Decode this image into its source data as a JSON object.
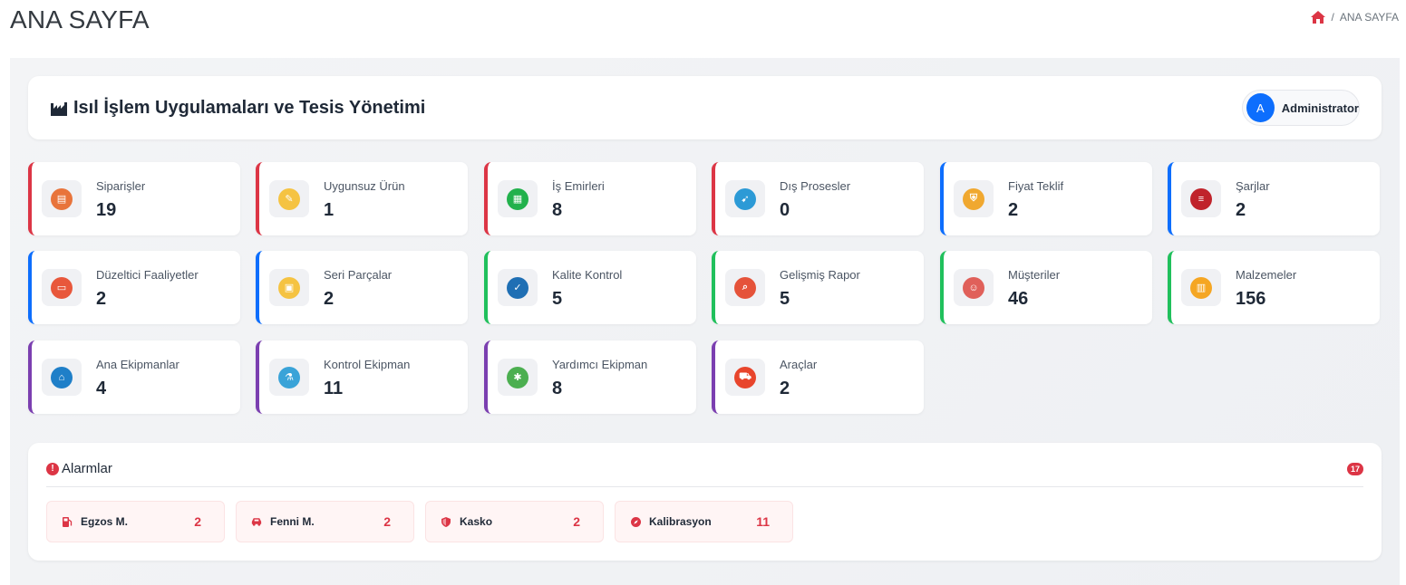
{
  "page": {
    "title": "ANA SAYFA"
  },
  "breadcrumb": {
    "separator": "/",
    "current": "ANA SAYFA"
  },
  "header": {
    "title": "Isıl İşlem Uygulamaları ve Tesis Yönetimi",
    "icon": "factory-icon"
  },
  "user": {
    "initial": "A",
    "name": "Administrator"
  },
  "stats": [
    {
      "label": "Siparişler",
      "value": "19",
      "icon": "orders-icon",
      "accent": "#dc3545",
      "icon_color": "#e8743b"
    },
    {
      "label": "Uygunsuz Ürün",
      "value": "1",
      "icon": "nonconforming-product-icon",
      "accent": "#dc3545",
      "icon_color": "#f5c342"
    },
    {
      "label": "İş Emirleri",
      "value": "8",
      "icon": "work-orders-icon",
      "accent": "#dc3545",
      "icon_color": "#22b14c"
    },
    {
      "label": "Dış Prosesler",
      "value": "0",
      "icon": "external-process-icon",
      "accent": "#dc3545",
      "icon_color": "#2c9ad6"
    },
    {
      "label": "Fiyat Teklif",
      "value": "2",
      "icon": "price-quote-icon",
      "accent": "#0d6efd",
      "icon_color": "#f0a830"
    },
    {
      "label": "Şarjlar",
      "value": "2",
      "icon": "charges-icon",
      "accent": "#0d6efd",
      "icon_color": "#c0232b"
    },
    {
      "label": "Düzeltici Faaliyetler",
      "value": "2",
      "icon": "corrective-actions-icon",
      "accent": "#0d6efd",
      "icon_color": "#e8573b"
    },
    {
      "label": "Seri Parçalar",
      "value": "2",
      "icon": "serial-parts-icon",
      "accent": "#0d6efd",
      "icon_color": "#f5c342"
    },
    {
      "label": "Kalite Kontrol",
      "value": "5",
      "icon": "quality-control-icon",
      "accent": "#20c05c",
      "icon_color": "#1f6fb4"
    },
    {
      "label": "Gelişmiş Rapor",
      "value": "5",
      "icon": "advanced-report-icon",
      "accent": "#20c05c",
      "icon_color": "#e5533a"
    },
    {
      "label": "Müşteriler",
      "value": "46",
      "icon": "customers-icon",
      "accent": "#20c05c",
      "icon_color": "#e0605a"
    },
    {
      "label": "Malzemeler",
      "value": "156",
      "icon": "materials-icon",
      "accent": "#20c05c",
      "icon_color": "#f5a623"
    },
    {
      "label": "Ana Ekipmanlar",
      "value": "4",
      "icon": "main-equipment-icon",
      "accent": "#7b3fb0",
      "icon_color": "#1f7fc8"
    },
    {
      "label": "Kontrol Ekipman",
      "value": "11",
      "icon": "control-equipment-icon",
      "accent": "#7b3fb0",
      "icon_color": "#3aa3d8"
    },
    {
      "label": "Yardımcı Ekipman",
      "value": "8",
      "icon": "auxiliary-equipment-icon",
      "accent": "#7b3fb0",
      "icon_color": "#4caf50"
    },
    {
      "label": "Araçlar",
      "value": "2",
      "icon": "vehicles-icon",
      "accent": "#7b3fb0",
      "icon_color": "#e8452c"
    }
  ],
  "alarms": {
    "title": "Alarmlar",
    "total": "17",
    "items": [
      {
        "label": "Egzos M.",
        "count": "2",
        "icon": "fuel-pump-icon"
      },
      {
        "label": "Fenni M.",
        "count": "2",
        "icon": "car-crash-icon"
      },
      {
        "label": "Kasko",
        "count": "2",
        "icon": "shield-icon"
      },
      {
        "label": "Kalibrasyon",
        "count": "11",
        "icon": "compass-icon"
      }
    ]
  }
}
